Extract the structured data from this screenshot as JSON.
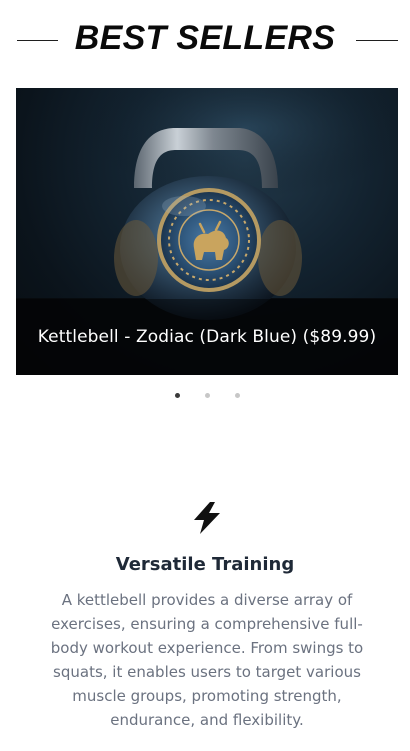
{
  "header": {
    "title": "BEST SELLERS"
  },
  "carousel": {
    "slides": [
      {
        "caption": "Kettlebell - Zodiac (Dark Blue) ($89.99)"
      }
    ],
    "active_index": 0,
    "dot_count": 3
  },
  "feature": {
    "icon": "lightning-bolt-icon",
    "title": "Versatile Training",
    "description": "A kettlebell provides a diverse array of exercises, ensuring a comprehensive full-body workout experience. From swings to squats, it enables users to target various muscle groups, promoting strength, endurance, and flexibility."
  },
  "colors": {
    "title_text": "#0a0a0a",
    "caption_text": "#ffffff",
    "feature_title": "#1f2937",
    "feature_text": "#6b7280",
    "dot_active": "#3a3a3a",
    "dot_inactive": "#c7c7c7"
  }
}
